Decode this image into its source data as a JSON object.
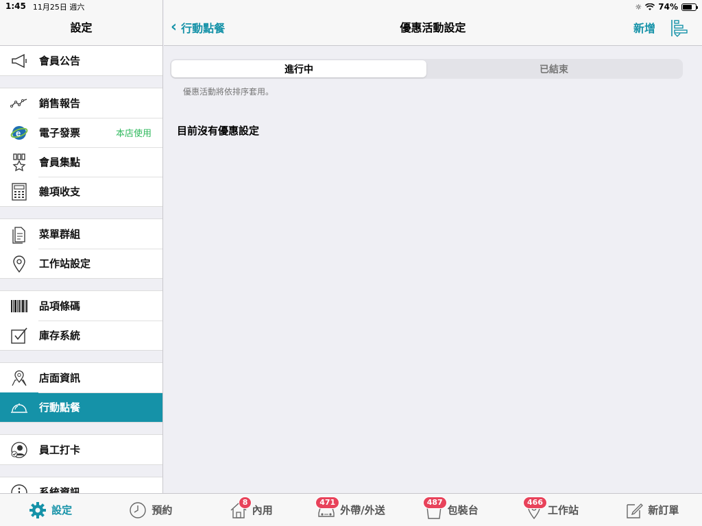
{
  "status_bar": {
    "time": "1:45",
    "date": "11月25日 週六",
    "battery": "74%"
  },
  "sidebar": {
    "title": "設定",
    "groups": [
      [
        {
          "label": "會員公告",
          "icon": "megaphone-icon"
        }
      ],
      [
        {
          "label": "銷售報告",
          "icon": "line-chart-icon"
        },
        {
          "label": "電子發票",
          "icon": "e-invoice-icon",
          "badge": "本店使用"
        },
        {
          "label": "會員集點",
          "icon": "award-star-icon"
        },
        {
          "label": "雜項收支",
          "icon": "calculator-icon"
        }
      ],
      [
        {
          "label": "菜單群組",
          "icon": "document-icon"
        },
        {
          "label": "工作站設定",
          "icon": "location-pin-icon"
        }
      ],
      [
        {
          "label": "品項條碼",
          "icon": "barcode-icon"
        },
        {
          "label": "庫存系統",
          "icon": "checkbox-icon"
        }
      ],
      [
        {
          "label": "店面資訊",
          "icon": "map-pin-icon"
        },
        {
          "label": "行動點餐",
          "icon": "food-cloche-icon",
          "active": true
        }
      ],
      [
        {
          "label": "員工打卡",
          "icon": "staff-check-icon"
        }
      ],
      [
        {
          "label": "系統資訊",
          "icon": "info-icon"
        }
      ]
    ]
  },
  "nav": {
    "back_label": "行動點餐",
    "title": "優惠活動設定",
    "add_label": "新增"
  },
  "segments": {
    "active": "進行中",
    "ended": "已結束"
  },
  "hint": "優惠活動將依排序套用。",
  "empty_message": "目前沒有優惠設定",
  "tabs": [
    {
      "label": "設定",
      "icon": "gear-icon",
      "active": true
    },
    {
      "label": "預約",
      "icon": "clock-icon"
    },
    {
      "label": "內用",
      "icon": "house-icon",
      "badge": "8"
    },
    {
      "label": "外帶/外送",
      "icon": "car-icon",
      "badge": "471"
    },
    {
      "label": "包裝台",
      "icon": "bag-icon",
      "badge": "487"
    },
    {
      "label": "工作站",
      "icon": "pin-icon",
      "badge": "466"
    },
    {
      "label": "新訂單",
      "icon": "edit-icon"
    }
  ],
  "colors": {
    "accent": "#1592a8",
    "badge": "#e8425a",
    "green": "#2eb85c"
  }
}
